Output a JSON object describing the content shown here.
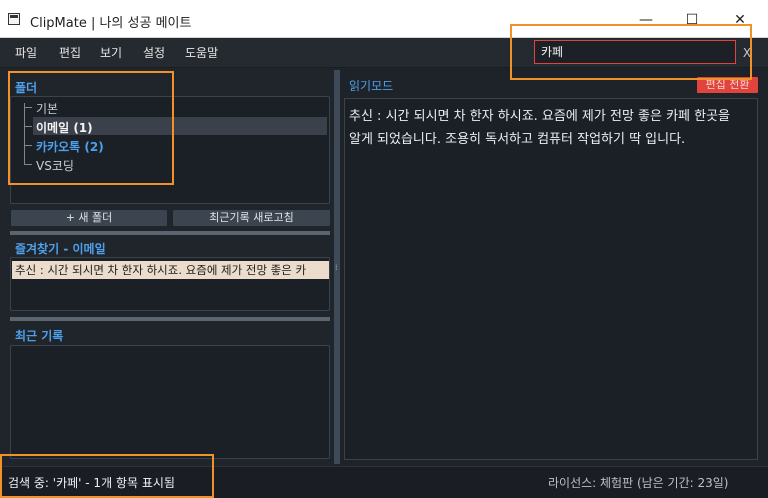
{
  "window": {
    "title": "ClipMate | 나의 성공 메이트",
    "controls": {
      "minimize": "—",
      "maximize": "☐",
      "close": "✕"
    }
  },
  "menu": {
    "items": [
      "파일",
      "편집",
      "보기",
      "설정",
      "도움말"
    ]
  },
  "search": {
    "value": "카페",
    "clear_label": "X"
  },
  "folders": {
    "title": "폴더",
    "items": [
      {
        "label": "기본",
        "count": ""
      },
      {
        "label": "이메일",
        "count": "(1)"
      },
      {
        "label": "카카오톡",
        "count": "(2)"
      },
      {
        "label": "VS코딩",
        "count": ""
      }
    ],
    "new_folder_label": "+ 새 폴더",
    "refresh_label": "최근기록 새로고침"
  },
  "favorites": {
    "title": "즐겨찾기 - 이메일",
    "items": [
      "추신 : 시간 되시면 차 한자 하시죠. 요즘에 제가 전망 좋은 카"
    ]
  },
  "recent": {
    "title": "최근 기록"
  },
  "reader": {
    "mode_label": "읽기모드",
    "edit_toggle_label": "편집 전환",
    "content": "추신 : 시간 되시면 차 한자 하시죠.  요즘에 제가 전망 좋은 카페 한곳을 알게 되었습니다. 조용히 독서하고 컴퓨터 작업하기 딱 입니다."
  },
  "status": {
    "search_info": "검색 중: '카페' - 1개 항목 표시됨",
    "license": "라이선스: 체험판 (남은 기간: 23일)"
  },
  "colors": {
    "accent": "#4ea0ea",
    "danger": "#e0443c",
    "annotation": "#f0912a"
  }
}
